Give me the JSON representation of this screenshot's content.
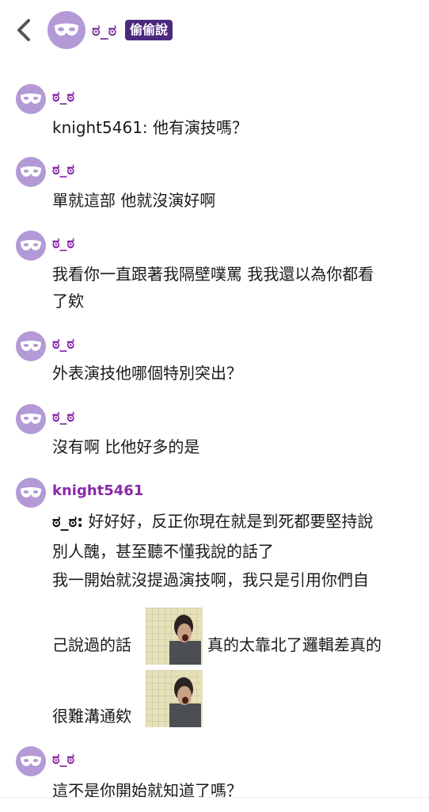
{
  "header": {
    "room_name": "ಠ_ಠ",
    "badge": "偷偷說"
  },
  "messages": [
    {
      "name": "ಠ_ಠ",
      "lines": [
        "knight5461: 他有演技嗎？"
      ]
    },
    {
      "name": "ಠ_ಠ",
      "lines": [
        "單就這部 他就沒演好啊"
      ]
    },
    {
      "name": "ಠ_ಠ",
      "lines": [
        "我看你一直跟著我隔壁噗罵 我我還以為你都看",
        "了欸"
      ]
    },
    {
      "name": "ಠ_ಠ",
      "lines": [
        "外表演技他哪個特別突出？"
      ]
    },
    {
      "name": "ಠ_ಠ",
      "lines": [
        "沒有啊 比他好多的是"
      ]
    },
    {
      "name": "knight5461",
      "quote_prefix": "ಠ_ಠ:",
      "lines": [
        "好好好，反正你現在就是到死都要堅持說",
        "別人醜，甚至聽不懂我說的話了",
        "我一開始就沒提過演技啊，我只是引用你們自"
      ],
      "sticker_lines": [
        "己說過的話",
        "真的太靠北了邏輯差真的",
        "很難溝通欸"
      ]
    },
    {
      "name": "ಠ_ಠ",
      "lines": [
        "這不是你開始就知道了嗎？"
      ]
    }
  ],
  "icons": {
    "back": "chevron-left-icon",
    "avatar": "mask-icon",
    "sticker": "screaming-man-sticker"
  },
  "colors": {
    "avatar_bg": "#b39ad6",
    "name_color": "#8a2aa8",
    "badge_bg": "#4b2a7e"
  }
}
